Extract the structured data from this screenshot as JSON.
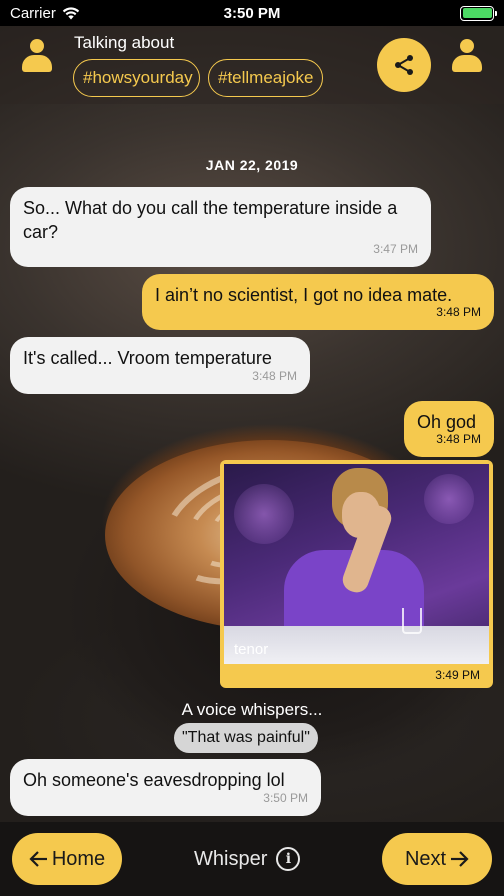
{
  "status_bar": {
    "carrier": "Carrier",
    "time": "3:50 PM",
    "battery_percent": 100
  },
  "header": {
    "talking_label": "Talking about",
    "hashtags": [
      "#howsyourday",
      "#tellmeajoke"
    ],
    "icons": {
      "left_avatar": "user-icon",
      "right_avatar": "user-icon",
      "share": "share-icon"
    }
  },
  "chat": {
    "date": "JAN 22, 2019",
    "messages": [
      {
        "side": "in",
        "text": "So... What do you call the temperature inside a car?",
        "time": "3:47 PM"
      },
      {
        "side": "out",
        "text": "I ain’t no scientist, I got no idea mate.",
        "time": "3:48 PM"
      },
      {
        "side": "in",
        "text": "It's called... Vroom temperature",
        "time": "3:48 PM"
      },
      {
        "side": "out",
        "text": "Oh god",
        "time": "3:48 PM"
      },
      {
        "side": "out",
        "type": "gif",
        "watermark": "tenor",
        "time": "3:49 PM"
      },
      {
        "side": "in",
        "text": "Oh someone's eavesdropping lol",
        "time": "3:50 PM"
      }
    ],
    "whisper": {
      "caption": "A voice whispers...",
      "text": "\"That was painful\""
    }
  },
  "bottom_bar": {
    "home_label": "Home",
    "whisper_label": "Whisper",
    "next_label": "Next"
  },
  "colors": {
    "accent": "#f5c94e",
    "incoming_bubble": "#f2f2f2",
    "bottom_bar": "#161413"
  }
}
